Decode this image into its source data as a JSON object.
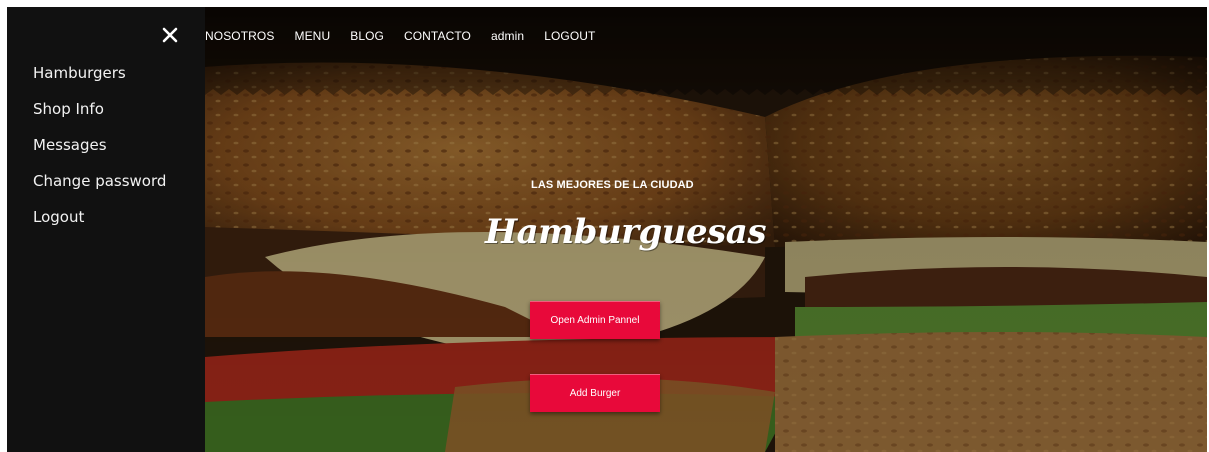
{
  "sidebar": {
    "items": [
      {
        "label": "Hamburgers"
      },
      {
        "label": "Shop Info"
      },
      {
        "label": "Messages"
      },
      {
        "label": "Change password"
      },
      {
        "label": "Logout"
      }
    ]
  },
  "nav": {
    "items": [
      {
        "label": "NOSOTROS"
      },
      {
        "label": "MENU"
      },
      {
        "label": "BLOG"
      },
      {
        "label": "CONTACTO"
      },
      {
        "label": "admin"
      },
      {
        "label": "LOGOUT"
      }
    ]
  },
  "hero": {
    "subtitle": "LAS MEJORES DE LA CIUDAD",
    "title": "Hamburguesas",
    "buttons": {
      "admin_label": "Open Admin Pannel",
      "add_label": "Add Burger"
    }
  },
  "icons": {
    "close": "close-icon"
  },
  "colors": {
    "accent": "#e8093a",
    "sidebar_bg": "#111111",
    "text_light": "#f2f2f2"
  }
}
